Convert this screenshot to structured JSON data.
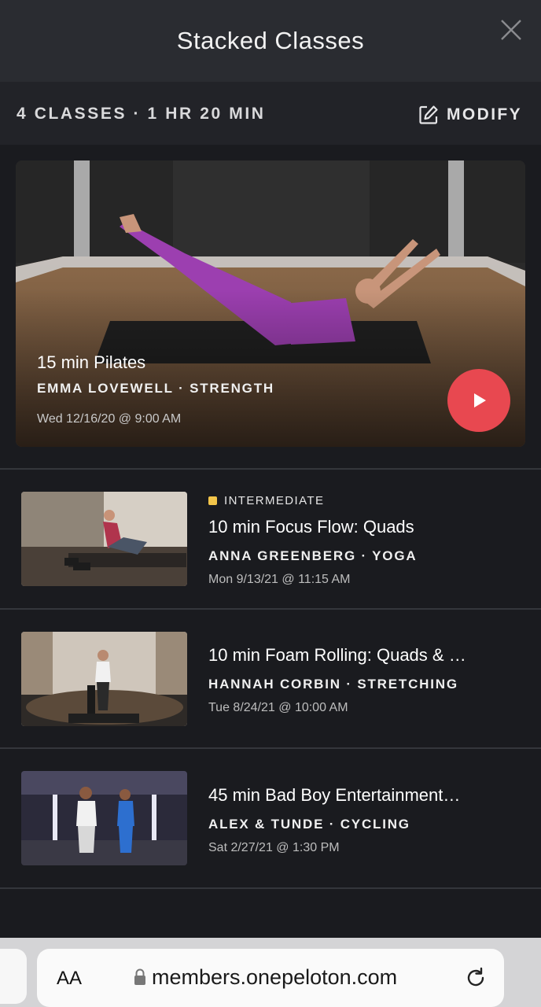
{
  "header": {
    "title": "Stacked Classes",
    "close_icon": "close-icon"
  },
  "summary": {
    "text": "4 CLASSES · 1 HR 20 MIN",
    "modify_label": "MODIFY",
    "modify_icon": "edit-icon"
  },
  "featured": {
    "title": "15 min Pilates",
    "meta": "EMMA LOVEWELL · STRENGTH",
    "date": "Wed 12/16/20 @ 9:00 AM",
    "play_icon": "play-icon",
    "play_color": "#e84850"
  },
  "classes": [
    {
      "level": "INTERMEDIATE",
      "level_color": "#f3c54a",
      "title": "10 min Focus Flow: Quads",
      "meta": "ANNA GREENBERG · YOGA",
      "date": "Mon 9/13/21 @ 11:15 AM"
    },
    {
      "title": "10 min Foam Rolling: Quads & …",
      "meta": "HANNAH CORBIN · STRETCHING",
      "date": "Tue 8/24/21 @ 10:00 AM"
    },
    {
      "title": "45 min Bad Boy Entertainment…",
      "meta": "ALEX & TUNDE · CYCLING",
      "date": "Sat 2/27/21 @ 1:30 PM"
    }
  ],
  "browser": {
    "aa_label": "AA",
    "url": "members.onepeloton.com",
    "lock_icon": "lock-icon",
    "reload_icon": "reload-icon"
  }
}
